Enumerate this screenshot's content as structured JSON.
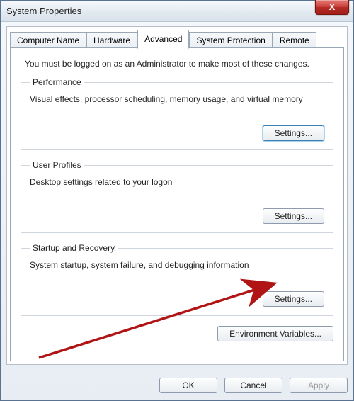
{
  "window": {
    "title": "System Properties"
  },
  "tabs": [
    {
      "label": "Computer Name"
    },
    {
      "label": "Hardware"
    },
    {
      "label": "Advanced",
      "active": true
    },
    {
      "label": "System Protection"
    },
    {
      "label": "Remote"
    }
  ],
  "advanced": {
    "intro": "You must be logged on as an Administrator to make most of these changes.",
    "performance": {
      "legend": "Performance",
      "desc": "Visual effects, processor scheduling, memory usage, and virtual memory",
      "button": "Settings..."
    },
    "userprofiles": {
      "legend": "User Profiles",
      "desc": "Desktop settings related to your logon",
      "button": "Settings..."
    },
    "startup": {
      "legend": "Startup and Recovery",
      "desc": "System startup, system failure, and debugging information",
      "button": "Settings..."
    },
    "env_button": "Environment Variables..."
  },
  "footer": {
    "ok": "OK",
    "cancel": "Cancel",
    "apply": "Apply"
  }
}
